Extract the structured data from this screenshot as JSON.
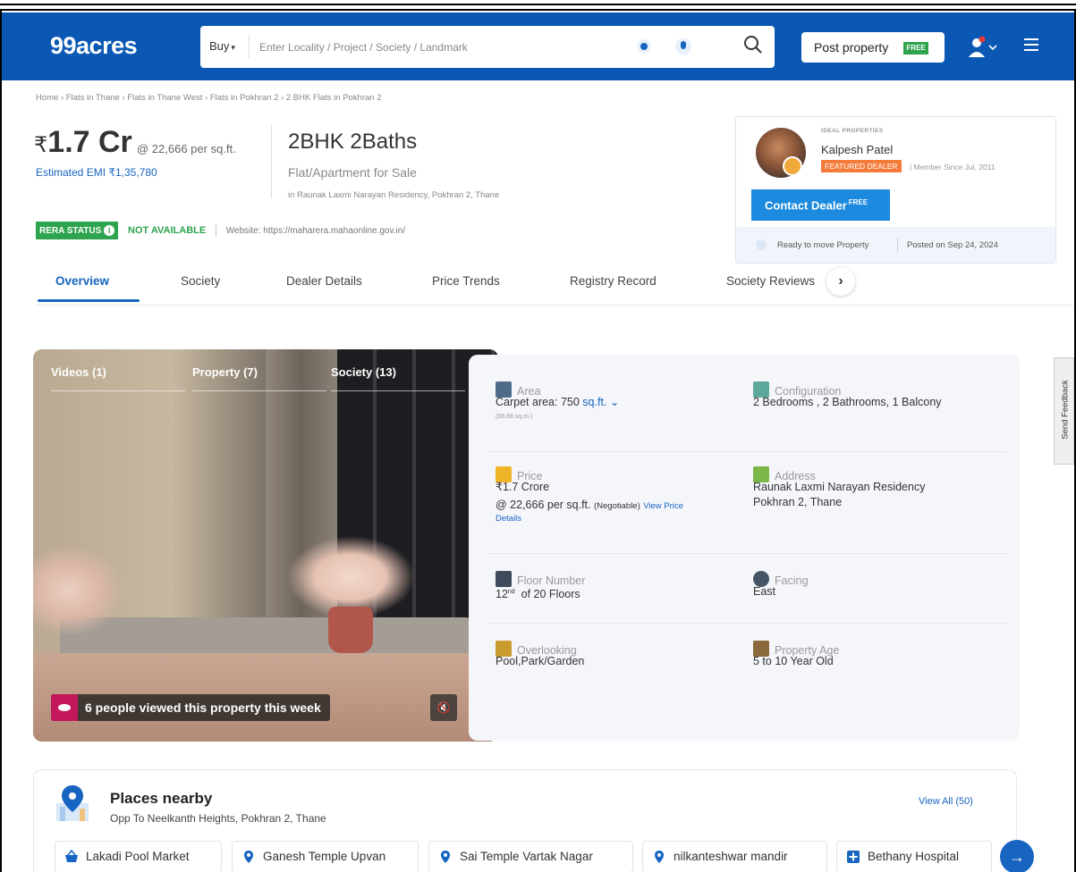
{
  "header": {
    "logo": "99acres",
    "buy_label": "Buy",
    "search_placeholder": "Enter Locality / Project / Society / Landmark",
    "post_label": "Post property",
    "free_tag": "FREE",
    "brand_color": "#0a58b4"
  },
  "breadcrumb": "Home › Flats in Thane › Flats in Thane West › Flats in Pokhran 2 › 2 BHK Flats in Pokhran 2",
  "price": {
    "currency": "₹",
    "amount": "1.7 Cr",
    "per_sqft": "@ 22,666 per sq.ft.",
    "emi": "Estimated EMI ₹1,35,780"
  },
  "property": {
    "title": "2BHK 2Baths",
    "type": "Flat/Apartment for Sale",
    "location": "in Raunak Laxmi Narayan Residency, Pokhran 2, Thane"
  },
  "rera": {
    "label": "RERA STATUS",
    "status": "NOT AVAILABLE",
    "website": "Website: https://maharera.mahaonline.gov.in/"
  },
  "dealer": {
    "org": "IDEAL PROPERTIES",
    "name": "Kalpesh Patel",
    "badge": "FEATURED DEALER",
    "member_since": "| Member Since Jul, 2011",
    "contact_label": "Contact Dealer",
    "contact_free": "FREE",
    "ready": "Ready to move Property",
    "posted": "Posted on Sep 24, 2024"
  },
  "tabs": [
    {
      "label": "Overview",
      "active": true
    },
    {
      "label": "Society"
    },
    {
      "label": "Dealer Details"
    },
    {
      "label": "Price Trends"
    },
    {
      "label": "Registry Record"
    },
    {
      "label": "Society Reviews"
    }
  ],
  "gallery": {
    "tabs": [
      "Videos (1)",
      "Property (7)",
      "Society (13)"
    ],
    "views_text": "6 people viewed this property this week"
  },
  "details": {
    "area": {
      "label": "Area",
      "value": "Carpet area: 750",
      "unit": "sq.ft.",
      "sub": "(69.68 sq.m.)"
    },
    "configuration": {
      "label": "Configuration",
      "value": "2 Bedrooms , 2 Bathrooms, 1 Balcony"
    },
    "price": {
      "label": "Price",
      "value": "₹1.7 Crore",
      "per": "@ 22,666 per sq.ft.",
      "negotiable": "(Negotiable)",
      "link1": "View Price",
      "link2": "Details"
    },
    "address": {
      "label": "Address",
      "line1": "Raunak Laxmi Narayan Residency",
      "line2": "Pokhran 2, Thane"
    },
    "floor": {
      "label": "Floor Number",
      "num": "12",
      "sup": "nd",
      "rest": "of 20 Floors"
    },
    "facing": {
      "label": "Facing",
      "value": "East"
    },
    "overlooking": {
      "label": "Overlooking",
      "value": "Pool,Park/Garden"
    },
    "age": {
      "label": "Property Age",
      "value": "5 to 10 Year Old"
    }
  },
  "feedback": "Send Feedback",
  "places": {
    "title": "Places nearby",
    "subtitle": "Opp To Neelkanth Heights, Pokhran 2, Thane",
    "view_all": "View All (50)",
    "chips": [
      "Lakadi Pool Market",
      "Ganesh Temple Upvan",
      "Sai Temple Vartak Nagar",
      "nilkanteshwar mandir",
      "Bethany Hospital"
    ]
  }
}
